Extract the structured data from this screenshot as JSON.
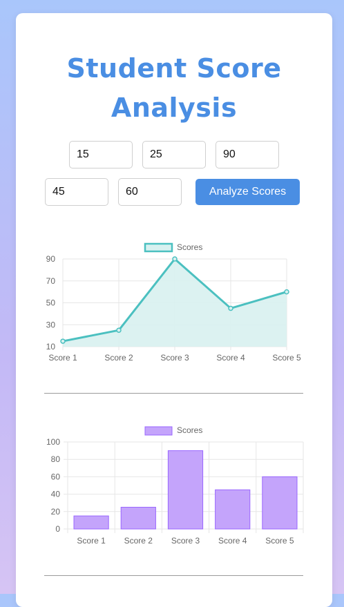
{
  "page": {
    "title": "Student Score Analysis"
  },
  "inputs": [
    {
      "value": "15"
    },
    {
      "value": "25"
    },
    {
      "value": "90"
    },
    {
      "value": "45"
    },
    {
      "value": "60"
    }
  ],
  "analyze_button": {
    "label": "Analyze Scores"
  },
  "colors": {
    "accent": "#4a8ee3",
    "line": "#4bc0c0",
    "line_fill": "#d8f1f0",
    "bar_fill": "#c4a4fb",
    "bar_border": "#9966ff"
  },
  "chart_data": [
    {
      "type": "line",
      "legend": "Scores",
      "legend_position": "top",
      "grid": true,
      "fill": true,
      "categories": [
        "Score 1",
        "Score 2",
        "Score 3",
        "Score 4",
        "Score 5"
      ],
      "values": [
        15,
        25,
        90,
        45,
        60
      ],
      "ylim": [
        10,
        90
      ],
      "yticks": [
        10,
        30,
        50,
        70,
        90
      ]
    },
    {
      "type": "bar",
      "legend": "Scores",
      "legend_position": "top",
      "grid": true,
      "categories": [
        "Score 1",
        "Score 2",
        "Score 3",
        "Score 4",
        "Score 5"
      ],
      "values": [
        15,
        25,
        90,
        45,
        60
      ],
      "ylim": [
        0,
        100
      ],
      "yticks": [
        0,
        20,
        40,
        60,
        80,
        100
      ]
    }
  ]
}
